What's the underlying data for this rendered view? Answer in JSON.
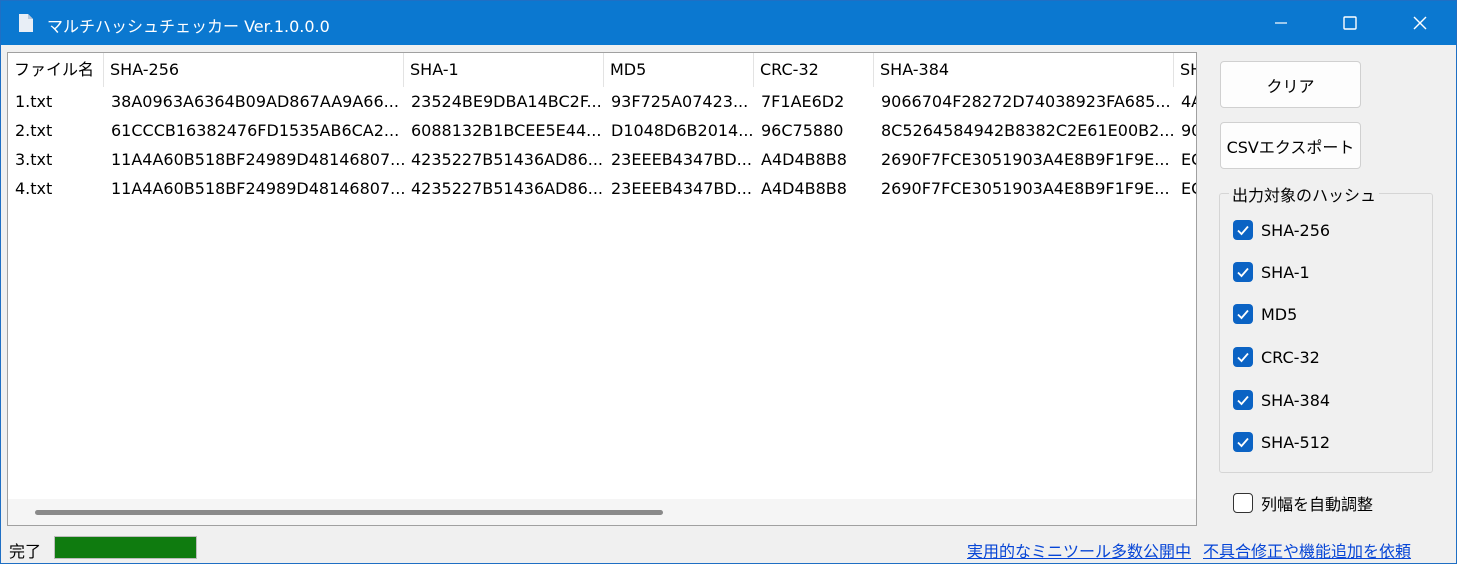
{
  "window": {
    "title": "マルチハッシュチェッカー Ver.1.0.0.0",
    "accent_color": "#0b78d0",
    "icons": {
      "app": "document-icon",
      "minimize": "minimize-icon",
      "maximize": "maximize-icon",
      "close": "close-icon"
    }
  },
  "grid": {
    "columns": [
      "ファイル名",
      "SHA-256",
      "SHA-1",
      "MD5",
      "CRC-32",
      "SHA-384",
      "SH"
    ],
    "rows": [
      [
        "1.txt",
        "38A0963A6364B09AD867AA9A66...",
        "23524BE9DBA14BC2F...",
        "93F725A07423...",
        "7F1AE6D2",
        "9066704F28272D74038923FA685...",
        "4A"
      ],
      [
        "2.txt",
        "61CCCB16382476FD1535AB6CA2...",
        "6088132B1BCEE5E44...",
        "D1048D6B2014...",
        "96C75880",
        "8C5264584942B8382C2E61E00B2...",
        "90"
      ],
      [
        "3.txt",
        "11A4A60B518BF24989D48146807...",
        "4235227B51436AD86...",
        "23EEEB4347BD...",
        "A4D4B8B8",
        "2690F7FCE3051903A4E8B9F1F9E...",
        "EC"
      ],
      [
        "4.txt",
        "11A4A60B518BF24989D48146807...",
        "4235227B51436AD86...",
        "23EEEB4347BD...",
        "A4D4B8B8",
        "2690F7FCE3051903A4E8B9F1F9E...",
        "EC"
      ]
    ]
  },
  "panel": {
    "clear_label": "クリア",
    "export_label": "CSVエクスポート",
    "group_title": "出力対象のハッシュ",
    "hash_options": [
      {
        "label": "SHA-256",
        "checked": true
      },
      {
        "label": "SHA-1",
        "checked": true
      },
      {
        "label": "MD5",
        "checked": true
      },
      {
        "label": "CRC-32",
        "checked": true
      },
      {
        "label": "SHA-384",
        "checked": true
      },
      {
        "label": "SHA-512",
        "checked": true
      }
    ],
    "auto_width": {
      "label": "列幅を自動調整",
      "checked": false
    },
    "check_color": "#0b63c4"
  },
  "status": {
    "text": "完了",
    "progress_percent": 100,
    "progress_color": "#0f7b0f",
    "links": [
      "実用的なミニツール多数公開中",
      "不具合修正や機能追加を依頼"
    ]
  }
}
